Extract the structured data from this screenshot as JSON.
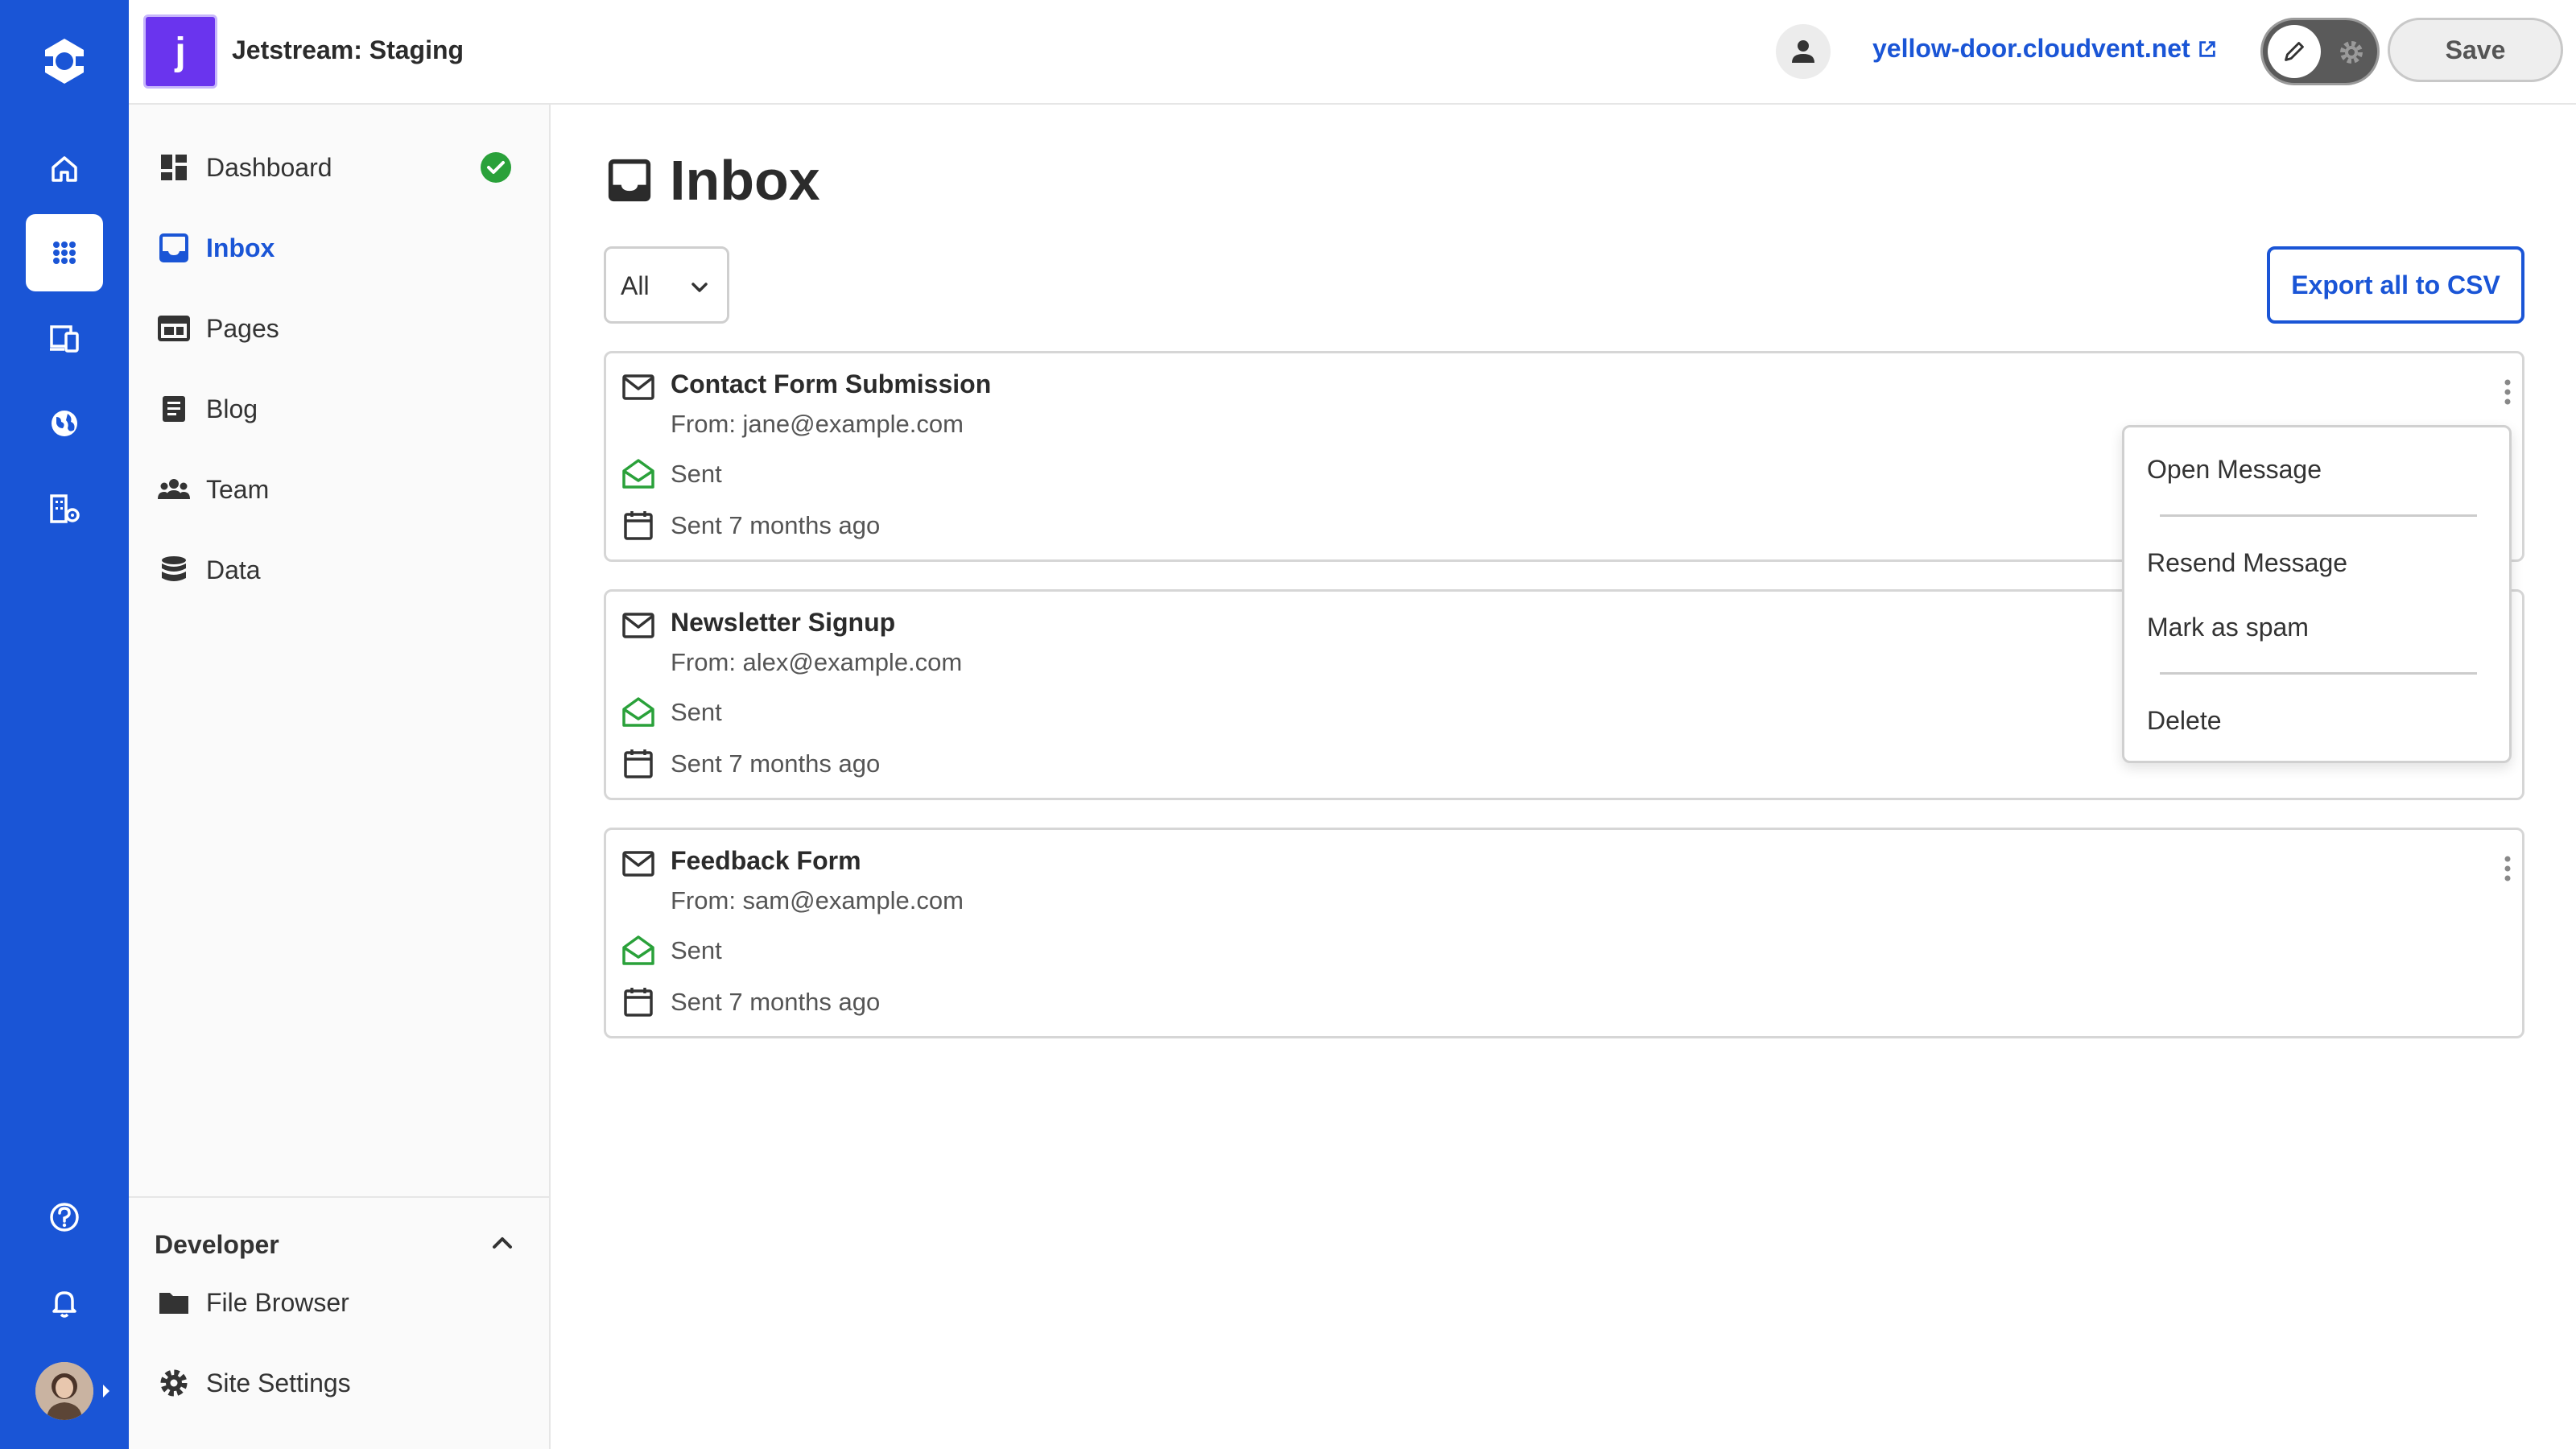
{
  "site": {
    "badge_letter": "j",
    "name": "Jetstream: Staging"
  },
  "topbar": {
    "site_link": "yellow-door.cloudvent.net",
    "save_label": "Save"
  },
  "rail": {
    "icons": [
      "home-icon",
      "apps-grid-icon",
      "devices-icon",
      "globe-icon",
      "building-settings-icon",
      "help-icon",
      "bell-icon"
    ]
  },
  "sidebar": {
    "items": [
      {
        "label": "Dashboard",
        "icon": "dashboard-icon",
        "status": "ok"
      },
      {
        "label": "Inbox",
        "icon": "inbox-icon",
        "active": true
      },
      {
        "label": "Pages",
        "icon": "pages-icon"
      },
      {
        "label": "Blog",
        "icon": "blog-icon"
      },
      {
        "label": "Team",
        "icon": "team-icon"
      },
      {
        "label": "Data",
        "icon": "database-icon"
      }
    ],
    "developer": {
      "title": "Developer",
      "items": [
        {
          "label": "File Browser",
          "icon": "folder-icon"
        },
        {
          "label": "Site Settings",
          "icon": "gear-icon"
        }
      ]
    }
  },
  "main": {
    "title": "Inbox",
    "filter": {
      "selected": "All"
    },
    "export_label": "Export all to CSV",
    "messages": [
      {
        "subject": "Contact Form Submission",
        "from": "From: jane@example.com",
        "status": "Sent",
        "time": "Sent 7 months ago"
      },
      {
        "subject": "Newsletter Signup",
        "from": "From: alex@example.com",
        "status": "Sent",
        "time": "Sent 7 months ago"
      },
      {
        "subject": "Feedback Form",
        "from": "From: sam@example.com",
        "status": "Sent",
        "time": "Sent 7 months ago"
      }
    ]
  },
  "context_menu": {
    "items": [
      "Open Message",
      "Resend Message",
      "Mark as spam",
      "Delete"
    ]
  },
  "colors": {
    "brand_blue": "#1a55d6",
    "site_badge": "#6a34ee",
    "status_green": "#2aa13a"
  }
}
